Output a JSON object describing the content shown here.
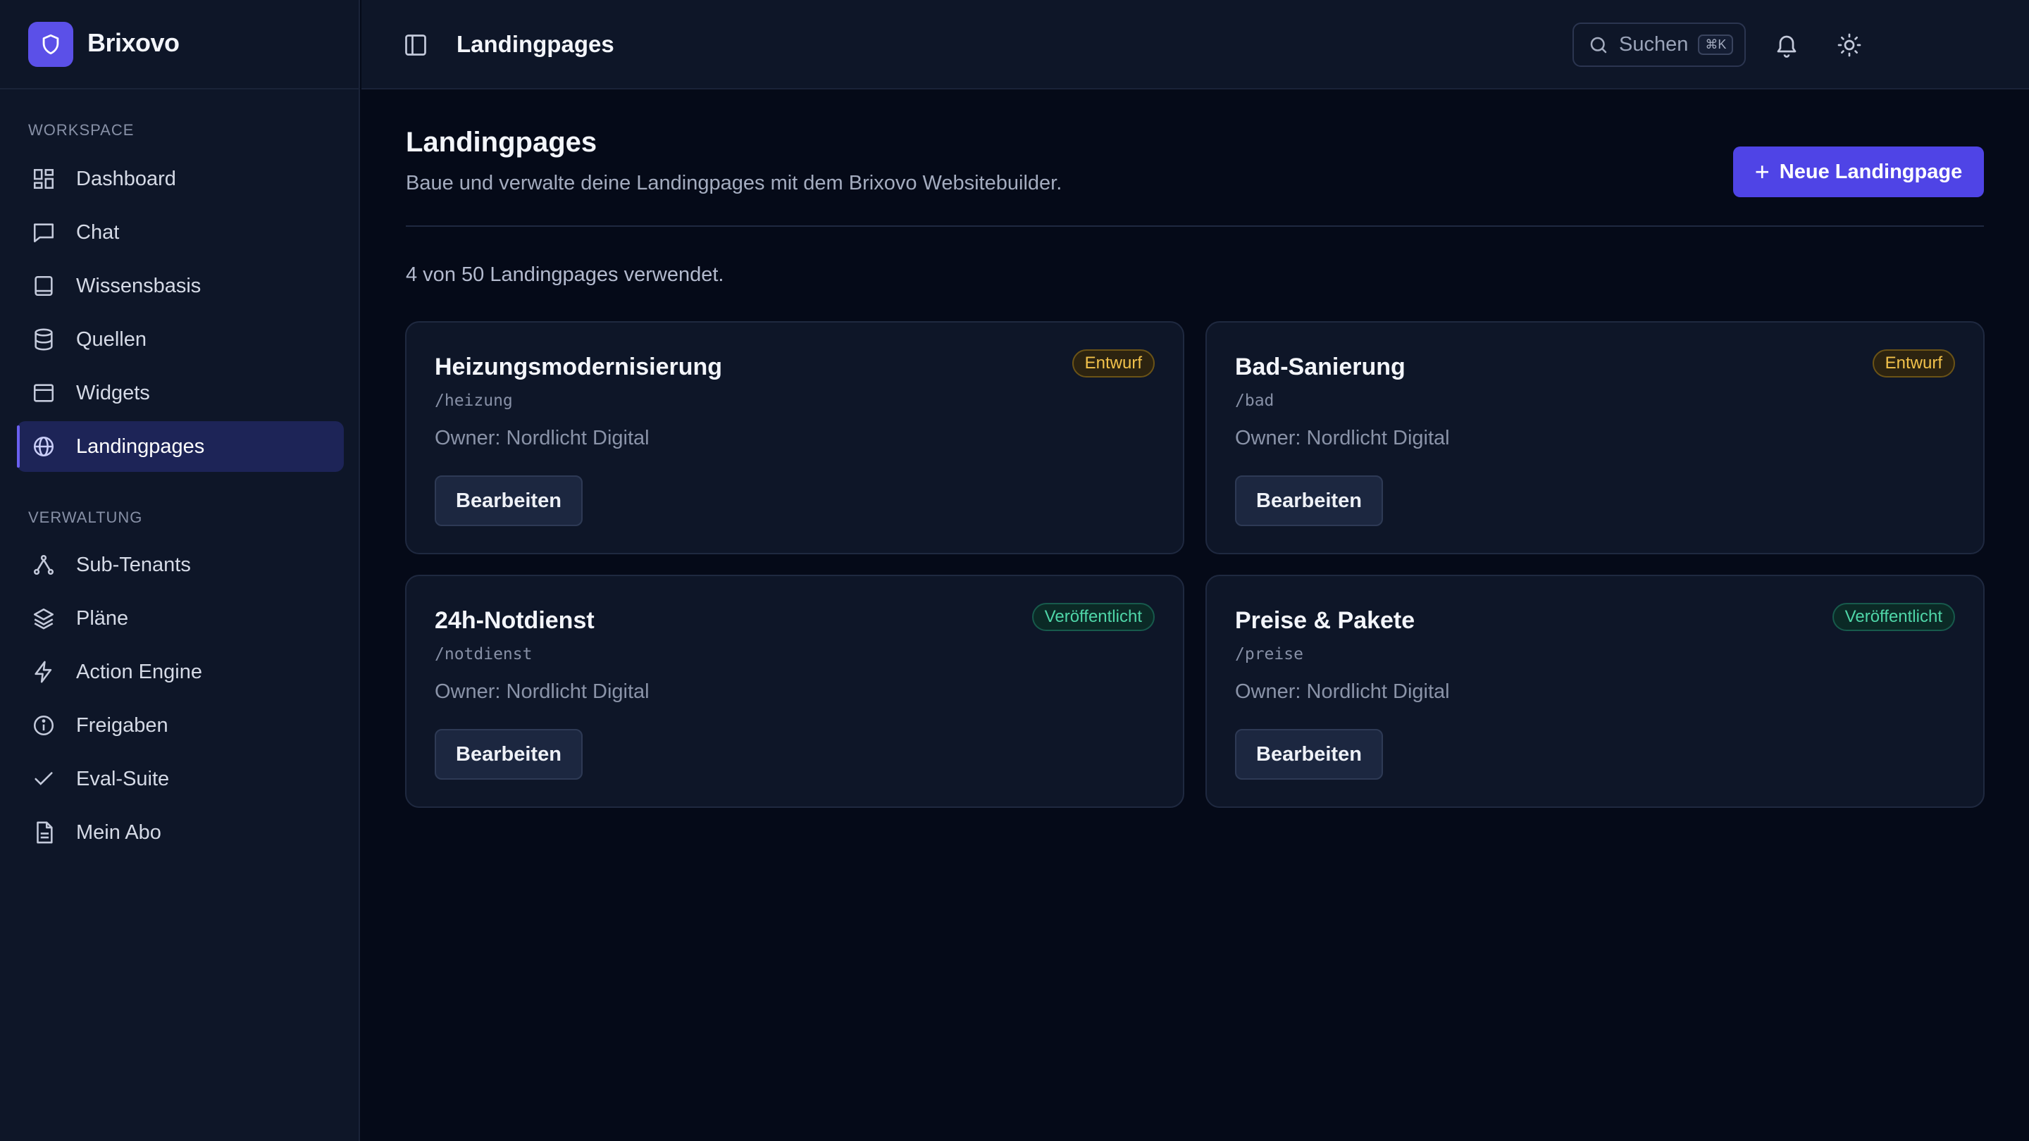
{
  "brand": {
    "name": "Brixovo",
    "accent": "#5b50e8"
  },
  "sidebar": {
    "sections": [
      {
        "label": "WORKSPACE",
        "items": [
          {
            "label": "Dashboard",
            "icon": "dashboard-icon",
            "active": false
          },
          {
            "label": "Chat",
            "icon": "chat-icon",
            "active": false
          },
          {
            "label": "Wissensbasis",
            "icon": "book-icon",
            "active": false
          },
          {
            "label": "Quellen",
            "icon": "database-icon",
            "active": false
          },
          {
            "label": "Widgets",
            "icon": "widget-icon",
            "active": false
          },
          {
            "label": "Landingpages",
            "icon": "globe-icon",
            "active": true
          }
        ]
      },
      {
        "label": "VERWALTUNG",
        "items": [
          {
            "label": "Sub-Tenants",
            "icon": "network-icon",
            "active": false
          },
          {
            "label": "Pläne",
            "icon": "layers-icon",
            "active": false
          },
          {
            "label": "Action Engine",
            "icon": "lightning-icon",
            "active": false
          },
          {
            "label": "Freigaben",
            "icon": "info-icon",
            "active": false
          },
          {
            "label": "Eval-Suite",
            "icon": "check-icon",
            "active": false
          },
          {
            "label": "Mein Abo",
            "icon": "document-icon",
            "active": false
          }
        ]
      }
    ]
  },
  "header": {
    "title": "Landingpages",
    "search_label": "Suchen",
    "search_shortcut": "⌘K"
  },
  "main": {
    "title": "Landingpages",
    "subtitle": "Baue und verwalte deine Landingpages mit dem Brixovo Websitebuilder.",
    "new_button_label": "Neue Landingpage",
    "usage_text": "4 von 50 Landingpages verwendet.",
    "cards": [
      {
        "title": "Heizungsmodernisierung",
        "slug": "/heizung",
        "owner": "Owner: Nordlicht Digital",
        "status": "Entwurf",
        "status_type": "draft",
        "edit_label": "Bearbeiten"
      },
      {
        "title": "Bad-Sanierung",
        "slug": "/bad",
        "owner": "Owner: Nordlicht Digital",
        "status": "Entwurf",
        "status_type": "draft",
        "edit_label": "Bearbeiten"
      },
      {
        "title": "24h-Notdienst",
        "slug": "/notdienst",
        "owner": "Owner: Nordlicht Digital",
        "status": "Veröffentlicht",
        "status_type": "published",
        "edit_label": "Bearbeiten"
      },
      {
        "title": "Preise & Pakete",
        "slug": "/preise",
        "owner": "Owner: Nordlicht Digital",
        "status": "Veröffentlicht",
        "status_type": "published",
        "edit_label": "Bearbeiten"
      }
    ]
  },
  "colors": {
    "draft": "#f2c24b",
    "published": "#4fd6a8",
    "primary": "#4f44e6"
  }
}
